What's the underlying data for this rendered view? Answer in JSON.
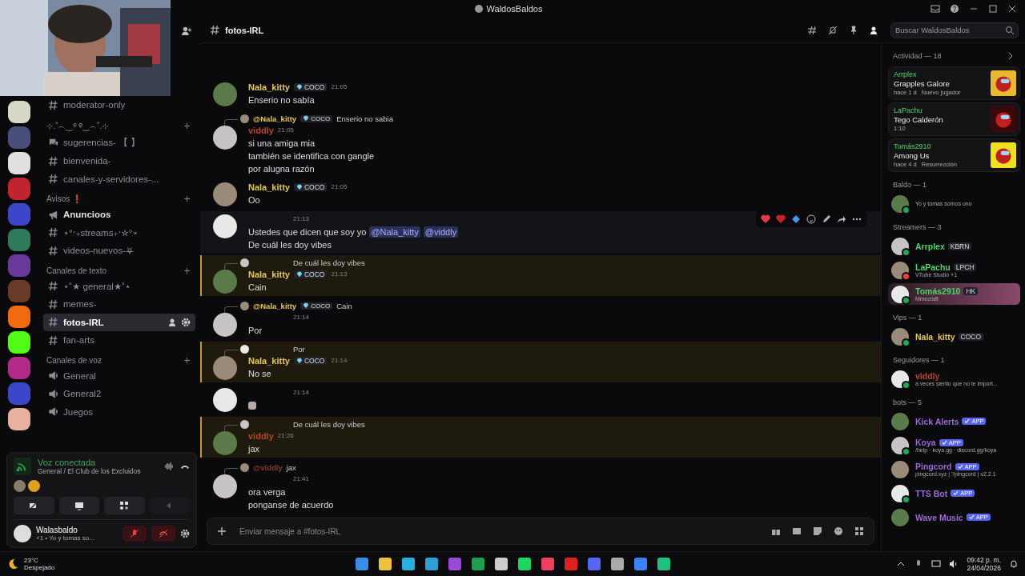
{
  "window": {
    "title": "WaldosBaldos"
  },
  "sidebar": {
    "items": [
      {
        "kind": "text_channel",
        "label": "moderator-only",
        "selected": false,
        "unread": false
      },
      {
        "kind": "category",
        "label": "⊹.˚︵‿୨ ୧‿︵˚.⊹"
      },
      {
        "kind": "forum",
        "label": "sugerencias- 【 】",
        "selected": false,
        "unread": false
      },
      {
        "kind": "text_channel",
        "label": "bienvenida-",
        "selected": false,
        "unread": false
      },
      {
        "kind": "text_channel",
        "label": "canales-y-servidores-...",
        "selected": false,
        "unread": false
      },
      {
        "kind": "category",
        "label": "Avisos ❗"
      },
      {
        "kind": "announcement",
        "label": "Anuncioos",
        "selected": false,
        "unread": true
      },
      {
        "kind": "text_channel",
        "label": "⋆°‧₊streams₊‧✮°⋆",
        "selected": false,
        "unread": false
      },
      {
        "kind": "text_channel",
        "label": "videos-nuevos-⛧",
        "selected": false,
        "unread": false
      },
      {
        "kind": "category",
        "label": "Canales de texto"
      },
      {
        "kind": "text_channel",
        "label": "⋆˚★ general★˚⋆",
        "selected": false,
        "unread": false
      },
      {
        "kind": "text_channel",
        "label": "memes-",
        "selected": false,
        "unread": false
      },
      {
        "kind": "text_channel",
        "label": "fotos-IRL",
        "selected": true,
        "unread": true
      },
      {
        "kind": "text_channel",
        "label": "fan-arts",
        "selected": false,
        "unread": false
      },
      {
        "kind": "category",
        "label": "Canales de voz"
      },
      {
        "kind": "voice_channel",
        "label": "General",
        "selected": false,
        "unread": false
      },
      {
        "kind": "voice_channel",
        "label": "General2",
        "selected": false,
        "unread": false
      },
      {
        "kind": "voice_channel",
        "label": "Juegos",
        "selected": false,
        "unread": false
      }
    ]
  },
  "voice": {
    "status": "Voz conectada",
    "channel": "General / El Club de los Excluidos"
  },
  "user": {
    "name": "Walasbaldo",
    "status": "+1 • Yo y tomas so...",
    "muted": true,
    "deafened": true
  },
  "channel": {
    "name": "fotos-IRL",
    "search_placeholder": "Buscar WaldosBaldos",
    "composer_placeholder": "Enviar mensaje a #fotos-IRL"
  },
  "messages": [
    {
      "author": "Nala_kitty",
      "color": "#e6c84d",
      "tag": "COCO",
      "time": "21:05",
      "highlighted": false,
      "hovered": false,
      "lines": [
        [
          {
            "kind": "text",
            "text": "Enserio no sabía"
          }
        ]
      ]
    },
    {
      "reply": {
        "author": "@Nala_kitty",
        "color": "#e6c84d",
        "tag": "COCO",
        "text": "Enserio no sabia"
      },
      "author": "viddly",
      "color": "#b8452a",
      "time": "21:05",
      "highlighted": false,
      "hovered": false,
      "lines": [
        [
          {
            "kind": "text",
            "text": "si una amiga mia"
          }
        ],
        [
          {
            "kind": "text",
            "text": "también se identifica con gangle"
          }
        ],
        [
          {
            "kind": "text",
            "text": "por alugna razón"
          }
        ]
      ]
    },
    {
      "author": "Nala_kitty",
      "color": "#e6c84d",
      "tag": "COCO",
      "time": "21:05",
      "highlighted": false,
      "hovered": false,
      "lines": [
        [
          {
            "kind": "text",
            "text": "Oo"
          }
        ]
      ]
    },
    {
      "time": "21:13",
      "highlighted": false,
      "hovered": true,
      "lines": [
        [
          {
            "kind": "text",
            "text": "Ustedes que dicen que soy yo"
          },
          {
            "kind": "mention",
            "text": "@Nala_kitty"
          },
          {
            "kind": "mention",
            "text": "@viddly"
          }
        ],
        [
          {
            "kind": "text",
            "text": "De cuál les doy vibes"
          }
        ]
      ]
    },
    {
      "reply": {
        "text": "De cuál les doy vibes"
      },
      "author": "Nala_kitty",
      "color": "#e6c84d",
      "tag": "COCO",
      "time": "21:13",
      "highlighted": true,
      "hovered": false,
      "lines": [
        [
          {
            "kind": "text",
            "text": "Cain"
          }
        ]
      ]
    },
    {
      "reply": {
        "author": "@Nala_kitty",
        "color": "#e6c84d",
        "tag": "COCO",
        "text": "Cain"
      },
      "time": "21:14",
      "highlighted": false,
      "hovered": false,
      "lines": [
        [
          {
            "kind": "text",
            "text": "Por"
          }
        ]
      ]
    },
    {
      "reply": {
        "text": "Por"
      },
      "author": "Nala_kitty",
      "color": "#e6c84d",
      "tag": "COCO",
      "time": "21:14",
      "highlighted": true,
      "hovered": false,
      "lines": [
        [
          {
            "kind": "text",
            "text": "No se"
          }
        ]
      ]
    },
    {
      "time": "21:14",
      "highlighted": false,
      "hovered": false,
      "lines": [
        [
          {
            "kind": "sticker"
          }
        ]
      ]
    },
    {
      "reply": {
        "text": "De cuál les doy vibes"
      },
      "author": "viddly",
      "color": "#b8452a",
      "time": "21:26",
      "highlighted": true,
      "hovered": false,
      "lines": [
        [
          {
            "kind": "text",
            "text": "jax"
          }
        ]
      ]
    },
    {
      "reply": {
        "author": "@viddly",
        "color": "#8a3a22",
        "text": "jax"
      },
      "time": "21:41",
      "highlighted": false,
      "hovered": false,
      "lines": [
        [
          {
            "kind": "text",
            "text": "ora verga"
          }
        ],
        [
          {
            "kind": "text",
            "text": "ponganse de acuerdo"
          }
        ]
      ]
    }
  ],
  "activity": {
    "title": "Actividad — 18",
    "cards": [
      {
        "user": "Arrplex",
        "title": "Grapples Galore",
        "detail": "hace 1 d",
        "extra": "Nuevo jugador"
      },
      {
        "user": "LaPachu",
        "title": "Tego Calderón",
        "detail": "1:10"
      },
      {
        "user": "Tomás2910",
        "title": "Among Us",
        "detail": "hace 4 d",
        "extra": "Resurrección"
      }
    ]
  },
  "member_groups": [
    {
      "title": "Baldo — 1",
      "members": [
        {
          "status": "Yo y tomas somos uno",
          "status_dot": {
            "color": "#23a55a"
          },
          "boosted": false
        }
      ]
    },
    {
      "title": "Streamers — 3",
      "members": [
        {
          "name": "Arrplex",
          "color": "#4fd26a",
          "tag": "KBRN",
          "status_dot": {
            "color": "#23a55a"
          },
          "boosted": false
        },
        {
          "name": "LaPachu",
          "color": "#4fd26a",
          "tag": "LPCH",
          "status": "VTube Studio +1",
          "status_dot": {
            "color": "#f23f43"
          },
          "boosted": false
        },
        {
          "name": "Tomás2910",
          "color": "#4fd26a",
          "tag": "HK",
          "status": "Minecraft",
          "status_dot": {
            "color": "#23a55a"
          },
          "boosted": true
        }
      ]
    },
    {
      "title": "Vips — 1",
      "members": [
        {
          "name": "Nala_kitty",
          "color": "#e6c84d",
          "tag": "COCO",
          "status_dot": {
            "color": "#23a55a"
          },
          "boosted": false
        }
      ]
    },
    {
      "title": "Seguidores — 1",
      "members": [
        {
          "name": "viddly",
          "color": "#b8452a",
          "status": "a veces siento que no le import...",
          "status_dot": {
            "color": "#23a55a"
          },
          "boosted": false
        }
      ]
    },
    {
      "title": "bots — 5",
      "members": [
        {
          "name": "Kick Alerts",
          "color": "#9b6ad6",
          "app": "APP",
          "boosted": false
        },
        {
          "name": "Koya",
          "color": "#9b6ad6",
          "app": "APP",
          "status": "/help · koya.gg · discord.gg/koya",
          "status_dot": {
            "color": "#23a55a"
          },
          "boosted": false
        },
        {
          "name": "Pingcord",
          "color": "#9b6ad6",
          "app": "APP",
          "status": "pingcord.xyz | ?pingcord | v2.2.1",
          "boosted": false
        },
        {
          "name": "TTS Bot",
          "color": "#9b6ad6",
          "app": "APP",
          "status_dot": {
            "color": "#23a55a"
          },
          "boosted": false
        },
        {
          "name": "Wave Music",
          "color": "#9b6ad6",
          "app": "APP",
          "boosted": false
        }
      ]
    }
  ],
  "taskbar": {
    "temperature": "23°C",
    "weather": "Despejado",
    "time": "09:42 p. m.",
    "date": "24/04/2026"
  }
}
